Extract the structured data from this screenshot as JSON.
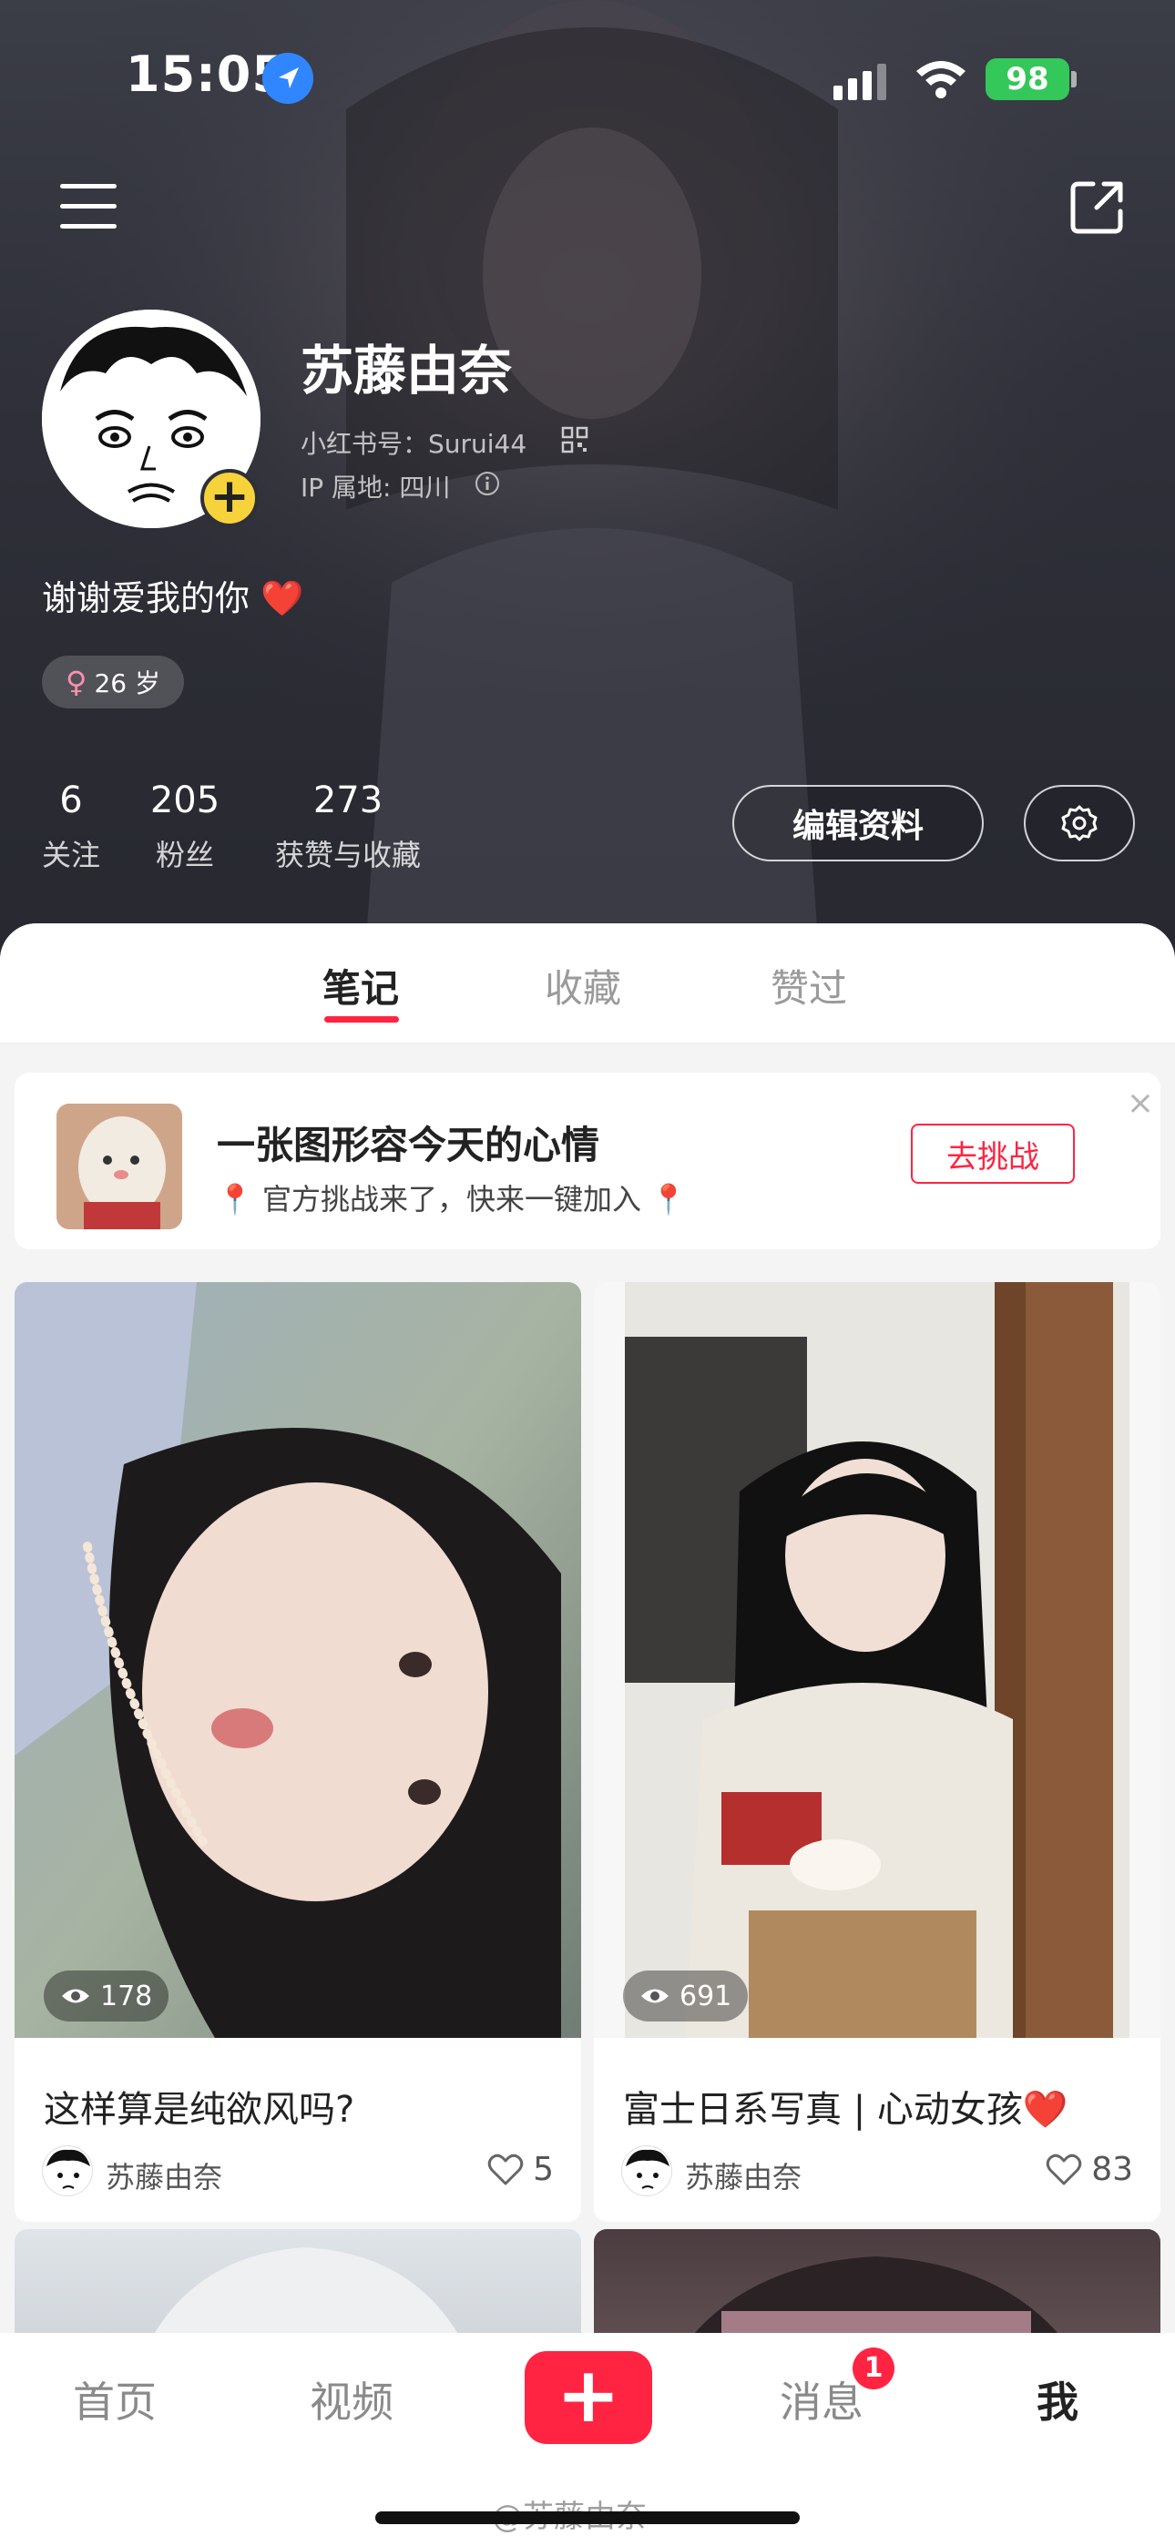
{
  "status_bar": {
    "time": "15:05",
    "battery": "98",
    "icons": [
      "location-arrow-icon",
      "cellular-signal-icon",
      "wifi-icon",
      "battery-icon"
    ]
  },
  "header": {
    "menu_icon": "hamburger-menu-icon",
    "share_icon": "share-icon",
    "nickname": "苏藤由奈",
    "red_id": "小红书号：Surui44",
    "ip_location": "IP 属地: 四川",
    "bio": "谢谢爱我的你 ❤️",
    "gender_age": "26 岁",
    "stats": [
      {
        "value": "6",
        "label": "关注"
      },
      {
        "value": "205",
        "label": "粉丝"
      },
      {
        "value": "273",
        "label": "获赞与收藏"
      }
    ],
    "edit_profile": "编辑资料"
  },
  "tabs": [
    {
      "label": "笔记",
      "active": true
    },
    {
      "label": "收藏",
      "active": false
    },
    {
      "label": "赞过",
      "active": false
    }
  ],
  "challenge": {
    "title": "一张图形容今天的心情",
    "subtitle": "📍 官方挑战来了，快来一键加入 📍",
    "button": "去挑战",
    "close": "×"
  },
  "notes": [
    {
      "title": "这样算是纯欲风吗?",
      "author": "苏藤由奈",
      "views": "178",
      "likes": "5"
    },
    {
      "title": "富士日系写真 | 心动女孩❤️",
      "author": "苏藤由奈",
      "views": "691",
      "likes": "83"
    }
  ],
  "bottom_nav": {
    "items": [
      {
        "label": "首页",
        "active": false
      },
      {
        "label": "视频",
        "active": false
      },
      {
        "label": "消息",
        "active": false,
        "badge": "1"
      },
      {
        "label": "我",
        "active": true
      }
    ],
    "add_label": "+"
  },
  "watermark": "@苏藤由奈",
  "colors": {
    "accent": "#ff2442",
    "header_bg": "#2f3039",
    "battery": "#34c759"
  }
}
